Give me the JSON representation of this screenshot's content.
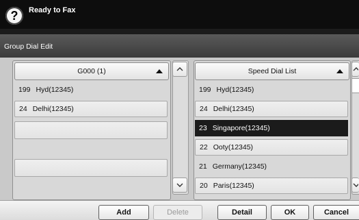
{
  "header": {
    "title": "Ready to Fax",
    "help_icon": "help-icon"
  },
  "subheader": {
    "title": "Group Dial Edit"
  },
  "group_list": {
    "header": "G000 (1)",
    "items": [
      {
        "num": "199",
        "label": "Hyd(12345)"
      },
      {
        "num": "24",
        "label": "Delhi(12345)"
      }
    ]
  },
  "speed_list": {
    "header": "Speed Dial List",
    "items": [
      {
        "num": "199",
        "label": "Hyd(12345)"
      },
      {
        "num": "24",
        "label": "Delhi(12345)"
      },
      {
        "num": "23",
        "label": "Singapore(12345)"
      },
      {
        "num": "22",
        "label": "Ooty(12345)"
      },
      {
        "num": "21",
        "label": "Germany(12345)"
      },
      {
        "num": "20",
        "label": "Paris(12345)"
      }
    ],
    "selected_index": 2
  },
  "buttons": {
    "add": "Add",
    "delete": "Delete",
    "detail": "Detail",
    "ok": "OK",
    "cancel": "Cancel"
  }
}
